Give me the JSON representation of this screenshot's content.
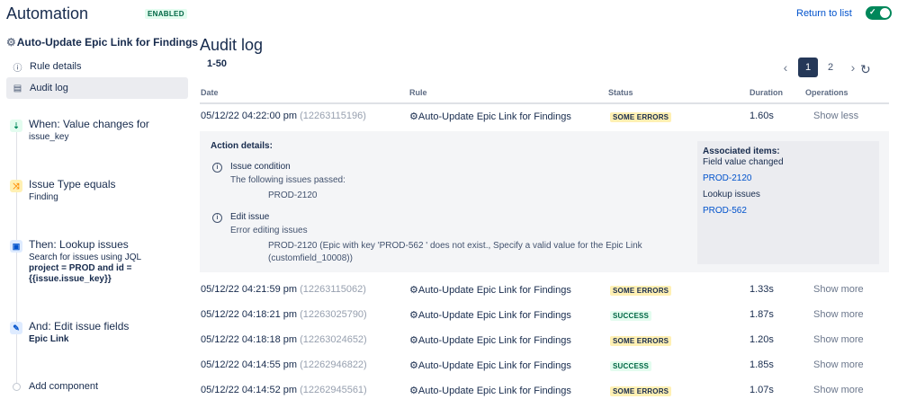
{
  "header": {
    "app_title": "Automation",
    "enabled_badge": "ENABLED",
    "return_link": "Return to list"
  },
  "sidebar": {
    "rule_name": "Auto-Update Epic Link for Findings",
    "nav": [
      {
        "label": "Rule details",
        "icon": "info-icon"
      },
      {
        "label": "Audit log",
        "icon": "document-icon"
      }
    ],
    "steps": [
      {
        "title": "When: Value changes for",
        "sub": "issue_key",
        "icon": "trigger-icon"
      },
      {
        "title": "Issue Type equals",
        "sub": "Finding",
        "icon": "shuffle-icon"
      },
      {
        "title": "Then: Lookup issues",
        "sub1": "Search for issues using JQL",
        "sub2": "project = PROD and id =",
        "sub3": "{{issue.issue_key}}",
        "icon": "lookup-icon"
      },
      {
        "title": "And: Edit issue fields",
        "sub": "Epic Link",
        "icon": "pencil-icon"
      }
    ],
    "add_component": "Add component"
  },
  "main": {
    "title": "Audit log",
    "range": "1-50",
    "pagination": {
      "pages": [
        "1",
        "2"
      ],
      "current": "1"
    },
    "columns": [
      "Date",
      "Rule",
      "Status",
      "Duration",
      "Operations"
    ],
    "rows": [
      {
        "date": "05/12/22 04:22:00 pm",
        "id": "(12263115196)",
        "rule": "Auto-Update Epic Link for Findings",
        "status": "SOME ERRORS",
        "duration": "1.60s",
        "op": "Show less"
      },
      {
        "date": "05/12/22 04:21:59 pm",
        "id": "(12263115062)",
        "rule": "Auto-Update Epic Link for Findings",
        "status": "SOME ERRORS",
        "duration": "1.33s",
        "op": "Show more"
      },
      {
        "date": "05/12/22 04:18:21 pm",
        "id": "(12263025790)",
        "rule": "Auto-Update Epic Link for Findings",
        "status": "SUCCESS",
        "duration": "1.87s",
        "op": "Show more"
      },
      {
        "date": "05/12/22 04:18:18 pm",
        "id": "(12263024652)",
        "rule": "Auto-Update Epic Link for Findings",
        "status": "SOME ERRORS",
        "duration": "1.20s",
        "op": "Show more"
      },
      {
        "date": "05/12/22 04:14:55 pm",
        "id": "(12262946822)",
        "rule": "Auto-Update Epic Link for Findings",
        "status": "SUCCESS",
        "duration": "1.85s",
        "op": "Show more"
      },
      {
        "date": "05/12/22 04:14:52 pm",
        "id": "(12262945561)",
        "rule": "Auto-Update Epic Link for Findings",
        "status": "SOME ERRORS",
        "duration": "1.07s",
        "op": "Show more"
      }
    ],
    "details": {
      "title": "Action details:",
      "condition": {
        "label": "Issue condition",
        "line": "The following issues passed:",
        "value": "PROD-2120"
      },
      "edit": {
        "label": "Edit issue",
        "line": "Error editing issues",
        "error1": "PROD-2120 (Epic with key 'PROD-562 ' does not exist., Specify a valid value for the Epic Link",
        "error2": "(customfield_10008))"
      },
      "associated": {
        "title": "Associated items:",
        "field_changed": "Field value changed",
        "link1": "PROD-2120",
        "lookup": "Lookup issues",
        "link2": "PROD-562"
      }
    }
  }
}
